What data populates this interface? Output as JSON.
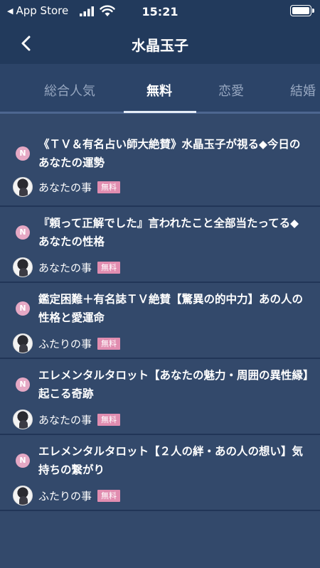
{
  "status_bar": {
    "back_app": "App Store",
    "time": "15:21"
  },
  "nav": {
    "title": "水晶玉子"
  },
  "tabs": [
    {
      "label": "総合人気",
      "active": false
    },
    {
      "label": "無料",
      "active": true
    },
    {
      "label": "恋愛",
      "active": false
    },
    {
      "label": "結婚",
      "active": false
    }
  ],
  "items": [
    {
      "badge": "N",
      "title": "《ＴＶ＆有名占い師大絶賛》水晶玉子が視る◆今日のあなたの運勢",
      "category": "あなたの事",
      "tag": "無料"
    },
    {
      "badge": "N",
      "title": "『頼って正解でした』言われたこと全部当たってる◆あなたの性格",
      "category": "あなたの事",
      "tag": "無料"
    },
    {
      "badge": "N",
      "title": "鑑定困難＋有名誌ＴＶ絶賛【驚異の的中力】あの人の性格と愛運命",
      "category": "ふたりの事",
      "tag": "無料"
    },
    {
      "badge": "N",
      "title": "エレメンタルタロット【あなたの魅力・周囲の異性縁】起こる奇跡",
      "category": "あなたの事",
      "tag": "無料"
    },
    {
      "badge": "N",
      "title": "エレメンタルタロット【２人の絆・あの人の想い】気持ちの繋がり",
      "category": "ふたりの事",
      "tag": "無料"
    }
  ],
  "colors": {
    "background": "#33496b",
    "header": "#223a5c",
    "badge": "#e5a8c4",
    "free_tag": "#e18db0"
  }
}
